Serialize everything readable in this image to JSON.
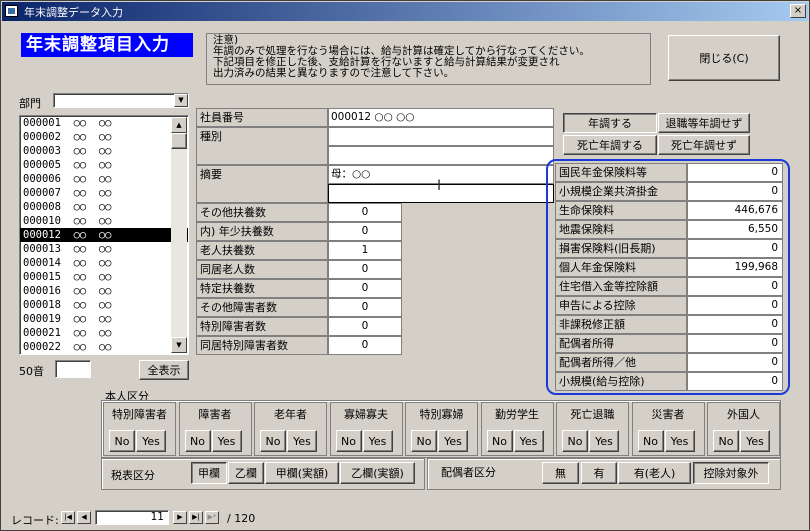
{
  "window": {
    "title": "年末調整データ入力",
    "close_glyph": "×"
  },
  "header": {
    "page_title": "年末調整項目入力",
    "notice_lines": [
      "注意)",
      "年調のみで処理を行なう場合には、給与計算は確定してから行なってください。",
      "下記項目を修正した後、支給計算を行ないますと給与計算結果が変更され",
      "出力済みの結果と異なりますので注意して下さい。"
    ],
    "close_button": "閉じる(C)"
  },
  "sidebar": {
    "dept_label": "部門",
    "dept_value": "",
    "employees": [
      "000001  ○○  ○○",
      "000002  ○○  ○○",
      "000003  ○○  ○○",
      "000005  ○○  ○○",
      "000006  ○○  ○○",
      "000007  ○○  ○○",
      "000008  ○○  ○○",
      "000010  ○○  ○○",
      "000012  ○○  ○○",
      "000013  ○○  ○○",
      "000014  ○○  ○○",
      "000015  ○○  ○○",
      "000016  ○○  ○○",
      "000018  ○○  ○○",
      "000019  ○○  ○○",
      "000021  ○○  ○○",
      "000022  ○○  ○○"
    ],
    "selected_index": 8,
    "kana_label": "50音",
    "kana_value": "",
    "show_all_button": "全表示"
  },
  "form": {
    "employee_no_label": "社員番号",
    "employee_no_value": "000012  ○○  ○○",
    "type_label": "種別",
    "type_value": "",
    "summary_label": "摘要",
    "summary_line1": "母：○○",
    "summary_line2": "",
    "dependents": [
      {
        "label": "その他扶養数",
        "value": "0"
      },
      {
        "label": "内) 年少扶養数",
        "value": "0"
      },
      {
        "label": "老人扶養数",
        "value": "1"
      },
      {
        "label": "同居老人数",
        "value": "0"
      },
      {
        "label": "特定扶養数",
        "value": "0"
      },
      {
        "label": "その他障害者数",
        "value": "0"
      },
      {
        "label": "特別障害者数",
        "value": "0"
      },
      {
        "label": "同居特別障害者数",
        "value": "0"
      }
    ]
  },
  "adjust_buttons": {
    "year_adjust": "年調する",
    "retire_no_adjust": "退職等年調せず",
    "death_adjust": "死亡年調する",
    "death_no_adjust": "死亡年調せず"
  },
  "deductions": [
    {
      "label": "国民年金保険料等",
      "value": "0"
    },
    {
      "label": "小規模企業共済掛金",
      "value": "0"
    },
    {
      "label": "生命保険料",
      "value": "446,676"
    },
    {
      "label": "地震保険料",
      "value": "6,550"
    },
    {
      "label": "損害保険料(旧長期)",
      "value": "0"
    },
    {
      "label": "個人年金保険料",
      "value": "199,968"
    },
    {
      "label": "住宅借入金等控除額",
      "value": "0"
    },
    {
      "label": "申告による控除",
      "value": "0"
    },
    {
      "label": "非課税修正額",
      "value": "0"
    },
    {
      "label": "配偶者所得",
      "value": "0"
    },
    {
      "label": "配偶者所得／他",
      "value": "0"
    },
    {
      "label": "小規模(給与控除)",
      "value": "0"
    }
  ],
  "personal_section": {
    "title": "本人区分",
    "no_label": "No",
    "yes_label": "Yes",
    "categories": [
      "特別障害者",
      "障害者",
      "老年者",
      "寡婦寡夫",
      "特別寡婦",
      "勤労学生",
      "死亡退職",
      "災害者",
      "外国人"
    ]
  },
  "tax_section": {
    "label": "税表区分",
    "options": [
      "甲欄",
      "乙欄",
      "甲欄(実額)",
      "乙欄(実額)"
    ],
    "selected": "甲欄"
  },
  "spouse_section": {
    "label": "配偶者区分",
    "options": [
      "無",
      "有",
      "有(老人)",
      "控除対象外"
    ],
    "selected": "控除対象外"
  },
  "navigator": {
    "label": "レコード:",
    "current": "11",
    "total": "/ 120"
  }
}
